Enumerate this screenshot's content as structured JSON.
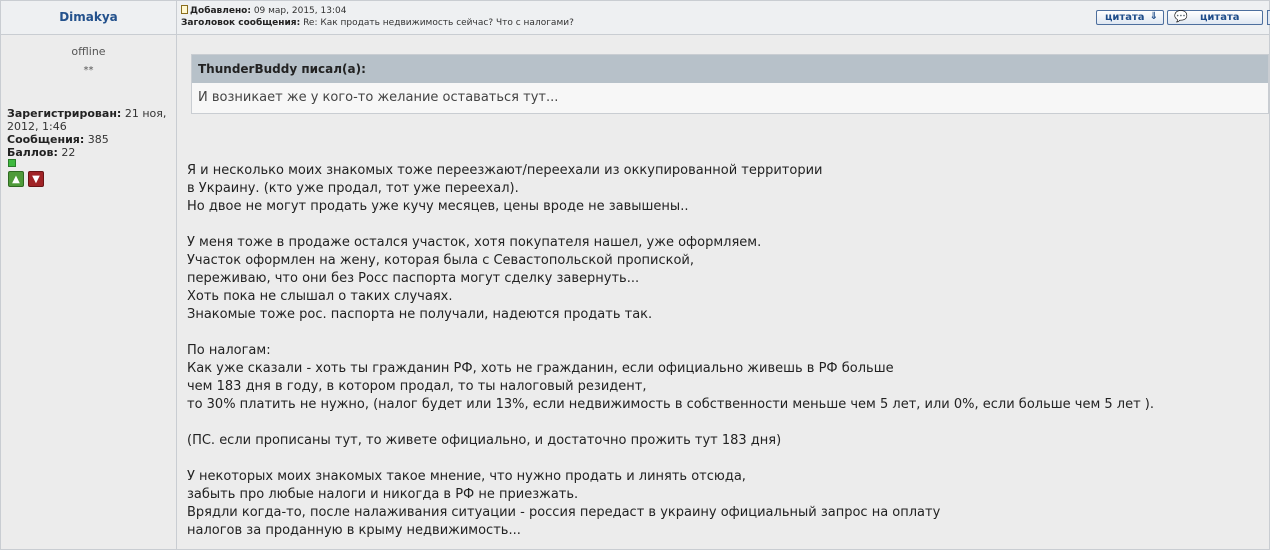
{
  "author": {
    "name": "Dimakya",
    "status": "offline",
    "rank": "**",
    "registered_label": "Зарегистрирован:",
    "registered_value": " 21 ноя, 2012, 1:46",
    "posts_label": "Сообщения:",
    "posts_value": " 385",
    "points_label": "Баллов:",
    "points_value": " 22",
    "vote_up_icon": "thumbs-up-icon",
    "vote_down_icon": "thumbs-down-icon"
  },
  "post": {
    "added_label": "Добавлено:",
    "added_value": " 09 мар, 2015, 13:04",
    "subject_label": "Заголовок сообщения:",
    "subject_value": " Re: Как продать недвижимость сейчас? Что с налогами?",
    "quote_button_1": "цитата",
    "quote_button_2": "цитата",
    "quote": {
      "header": "ThunderBuddy писал(а):",
      "text": "И возникает же у кого-то желание оставаться тут..."
    },
    "body_lines": [
      "Я и несколько моих знакомых тоже переезжают/переехали из оккупированной территории",
      "в Украину. (кто уже продал, тот уже переехал).",
      "Но двое не могут продать уже кучу месяцев, цены вроде не завышены..",
      "",
      "У меня тоже в продаже остался участок, хотя покупателя нашел, уже оформляем.",
      "Участок оформлен на жену, которая была с Севастопольской пропиской,",
      "переживаю, что они без Росс паспорта могут сделку завернуть...",
      "Хоть пока не слышал о таких случаях.",
      "Знакомые тоже рос. паспорта не получали, надеются продать так.",
      "",
      "По налогам:",
      "Как уже сказали - хоть ты гражданин РФ, хоть не гражданин, если официально живешь в РФ больше",
      "чем 183 дня в году, в котором продал, то ты налоговый резидент,",
      "то 30% платить не нужно, (налог будет или 13%, если недвижимость в собственности меньше чем 5 лет, или 0%, если больше чем 5 лет ).",
      "",
      "(ПС. если прописаны тут, то живете официально, и достаточно прожить тут 183 дня)",
      "",
      "У некоторых моих знакомых такое мнение, что нужно продать и линять отсюда,",
      "забыть про любые налоги и никогда в РФ не приезжать.",
      "Врядли когда-то, после налаживания ситуации - россия передаст в украину официальный запрос на оплату",
      "налогов за проданную в крыму недвижимость..."
    ]
  }
}
